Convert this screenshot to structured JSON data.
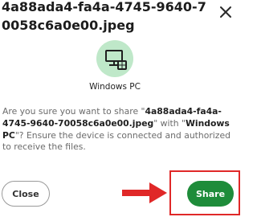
{
  "dialog": {
    "title": "4a88ada4-fa4a-4745-9640-70058c6a0e00.jpeg",
    "close_icon": "close-icon"
  },
  "device": {
    "name": "Windows PC",
    "icon": "monitor-windows-icon",
    "circle_color": "#bfe8c9"
  },
  "message": {
    "prefix": "Are you sure you want to share \"",
    "file": "4a88ada4-fa4a-4745-9640-70058c6a0e00.jpeg",
    "middle": "\" with \"",
    "device": "Windows PC",
    "suffix": "\"? Ensure the device is connected and authorized to receive the files."
  },
  "actions": {
    "close_label": "Close",
    "share_label": "Share",
    "share_color": "#1e8c3a",
    "annotation_color": "#e02828",
    "arrow_icon": "arrow-right-icon"
  }
}
